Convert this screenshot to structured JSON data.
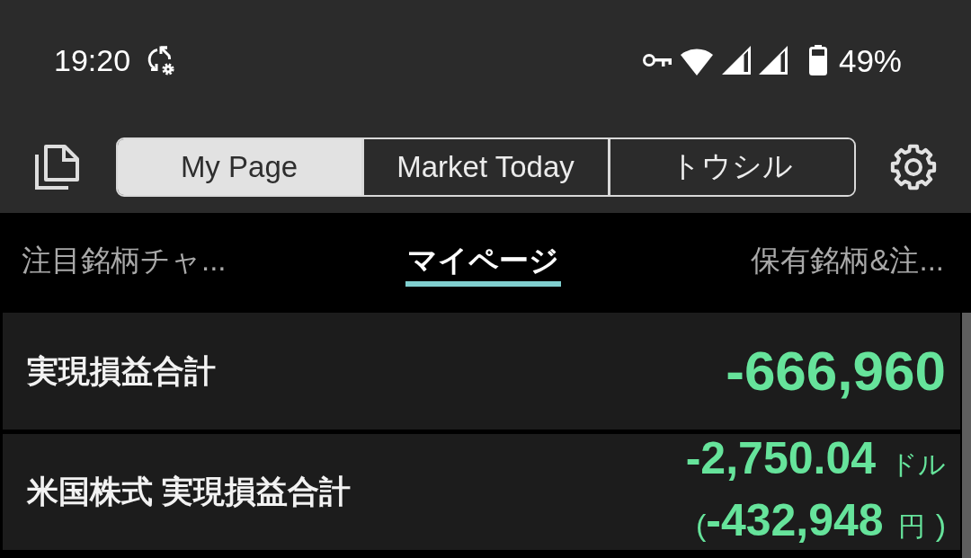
{
  "status_bar": {
    "time": "19:20",
    "battery": "49%"
  },
  "header": {
    "tabs": [
      {
        "label": "My Page",
        "selected": true
      },
      {
        "label": "Market Today",
        "selected": false
      },
      {
        "label": "トウシル",
        "selected": false
      }
    ]
  },
  "sub_tabs": [
    {
      "label": "注目銘柄チャ...",
      "selected": false
    },
    {
      "label": "マイページ",
      "selected": true
    },
    {
      "label": "保有銘柄&注...",
      "selected": false
    }
  ],
  "summary_rows": [
    {
      "kind": "single",
      "label": "実現損益合計",
      "value": "-666,960"
    },
    {
      "kind": "currency",
      "label": "米国株式 実現損益合計",
      "value": "-2,750.04",
      "unit": "ドル",
      "converted": {
        "open": "(",
        "value": "-432,948",
        "unit": "円",
        "close": ")"
      }
    }
  ]
}
